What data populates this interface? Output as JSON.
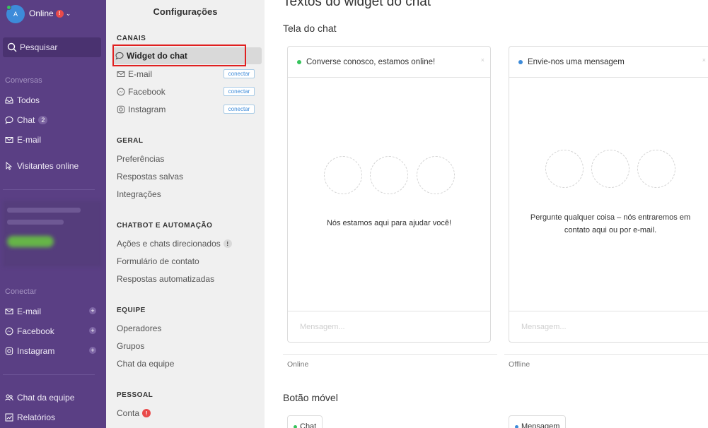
{
  "nav": {
    "avatar_letter": "A",
    "status_label": "Online",
    "status_alert": "!",
    "search_placeholder": "Pesquisar",
    "sections": {
      "conversations": "Conversas",
      "connect": "Conectar"
    },
    "conversation_items": [
      {
        "label": "Todos",
        "icon": "inbox-icon"
      },
      {
        "label": "Chat",
        "icon": "chat-bubble-icon",
        "count": "2"
      },
      {
        "label": "E-mail",
        "icon": "mail-icon"
      },
      {
        "label": "Visitantes online",
        "icon": "cursor-icon"
      }
    ],
    "connect_items": [
      {
        "label": "E-mail",
        "icon": "mail-icon"
      },
      {
        "label": "Facebook",
        "icon": "messenger-icon"
      },
      {
        "label": "Instagram",
        "icon": "instagram-icon"
      }
    ],
    "footer_items": [
      {
        "label": "Chat da equipe",
        "icon": "team-icon"
      },
      {
        "label": "Relatórios",
        "icon": "chart-icon"
      }
    ]
  },
  "settings": {
    "title": "Configurações",
    "groups": {
      "canais": "CANAIS",
      "geral": "GERAL",
      "chatbot": "CHATBOT E AUTOMAÇÃO",
      "equipe": "EQUIPE",
      "pessoal": "PESSOAL"
    },
    "channels": [
      {
        "label": "Widget do chat",
        "icon": "chat-bubble-icon"
      },
      {
        "label": "E-mail",
        "icon": "mail-icon",
        "action": "conectar"
      },
      {
        "label": "Facebook",
        "icon": "messenger-icon",
        "action": "conectar"
      },
      {
        "label": "Instagram",
        "icon": "instagram-icon",
        "action": "conectar"
      }
    ],
    "geral_items": [
      "Preferências",
      "Respostas salvas",
      "Integrações"
    ],
    "chatbot_items": [
      "Ações e chats direcionados",
      "Formulário de contato",
      "Respostas automatizadas"
    ],
    "chatbot_warning": "!",
    "equipe_items": [
      "Operadores",
      "Grupos",
      "Chat da equipe"
    ],
    "pessoal_items": [
      "Conta"
    ],
    "pessoal_warning": "!"
  },
  "main": {
    "page_title": "Textos do widget do chat",
    "chat_screen_title": "Tela do chat",
    "mobile_button_title": "Botão móvel",
    "online_widget": {
      "header": "Converse conosco, estamos online!",
      "status_color": "#36c45c",
      "message": "Nós estamos aqui para ajudar você!",
      "input_placeholder": "Mensagem...",
      "state_label": "Online",
      "button_label": "Chat"
    },
    "offline_widget": {
      "header": "Envie-nos uma mensagem",
      "status_color": "#3d8bd9",
      "message": "Pergunte qualquer coisa – nós entraremos em contato aqui ou por e-mail.",
      "input_placeholder": "Mensagem...",
      "state_label": "Offline",
      "button_label": "Mensagem"
    }
  },
  "colors": {
    "nav_bg": "#5a3f84",
    "settings_bg": "#f0f0f0",
    "highlight": "#e02020",
    "alert": "#e94a4a"
  }
}
